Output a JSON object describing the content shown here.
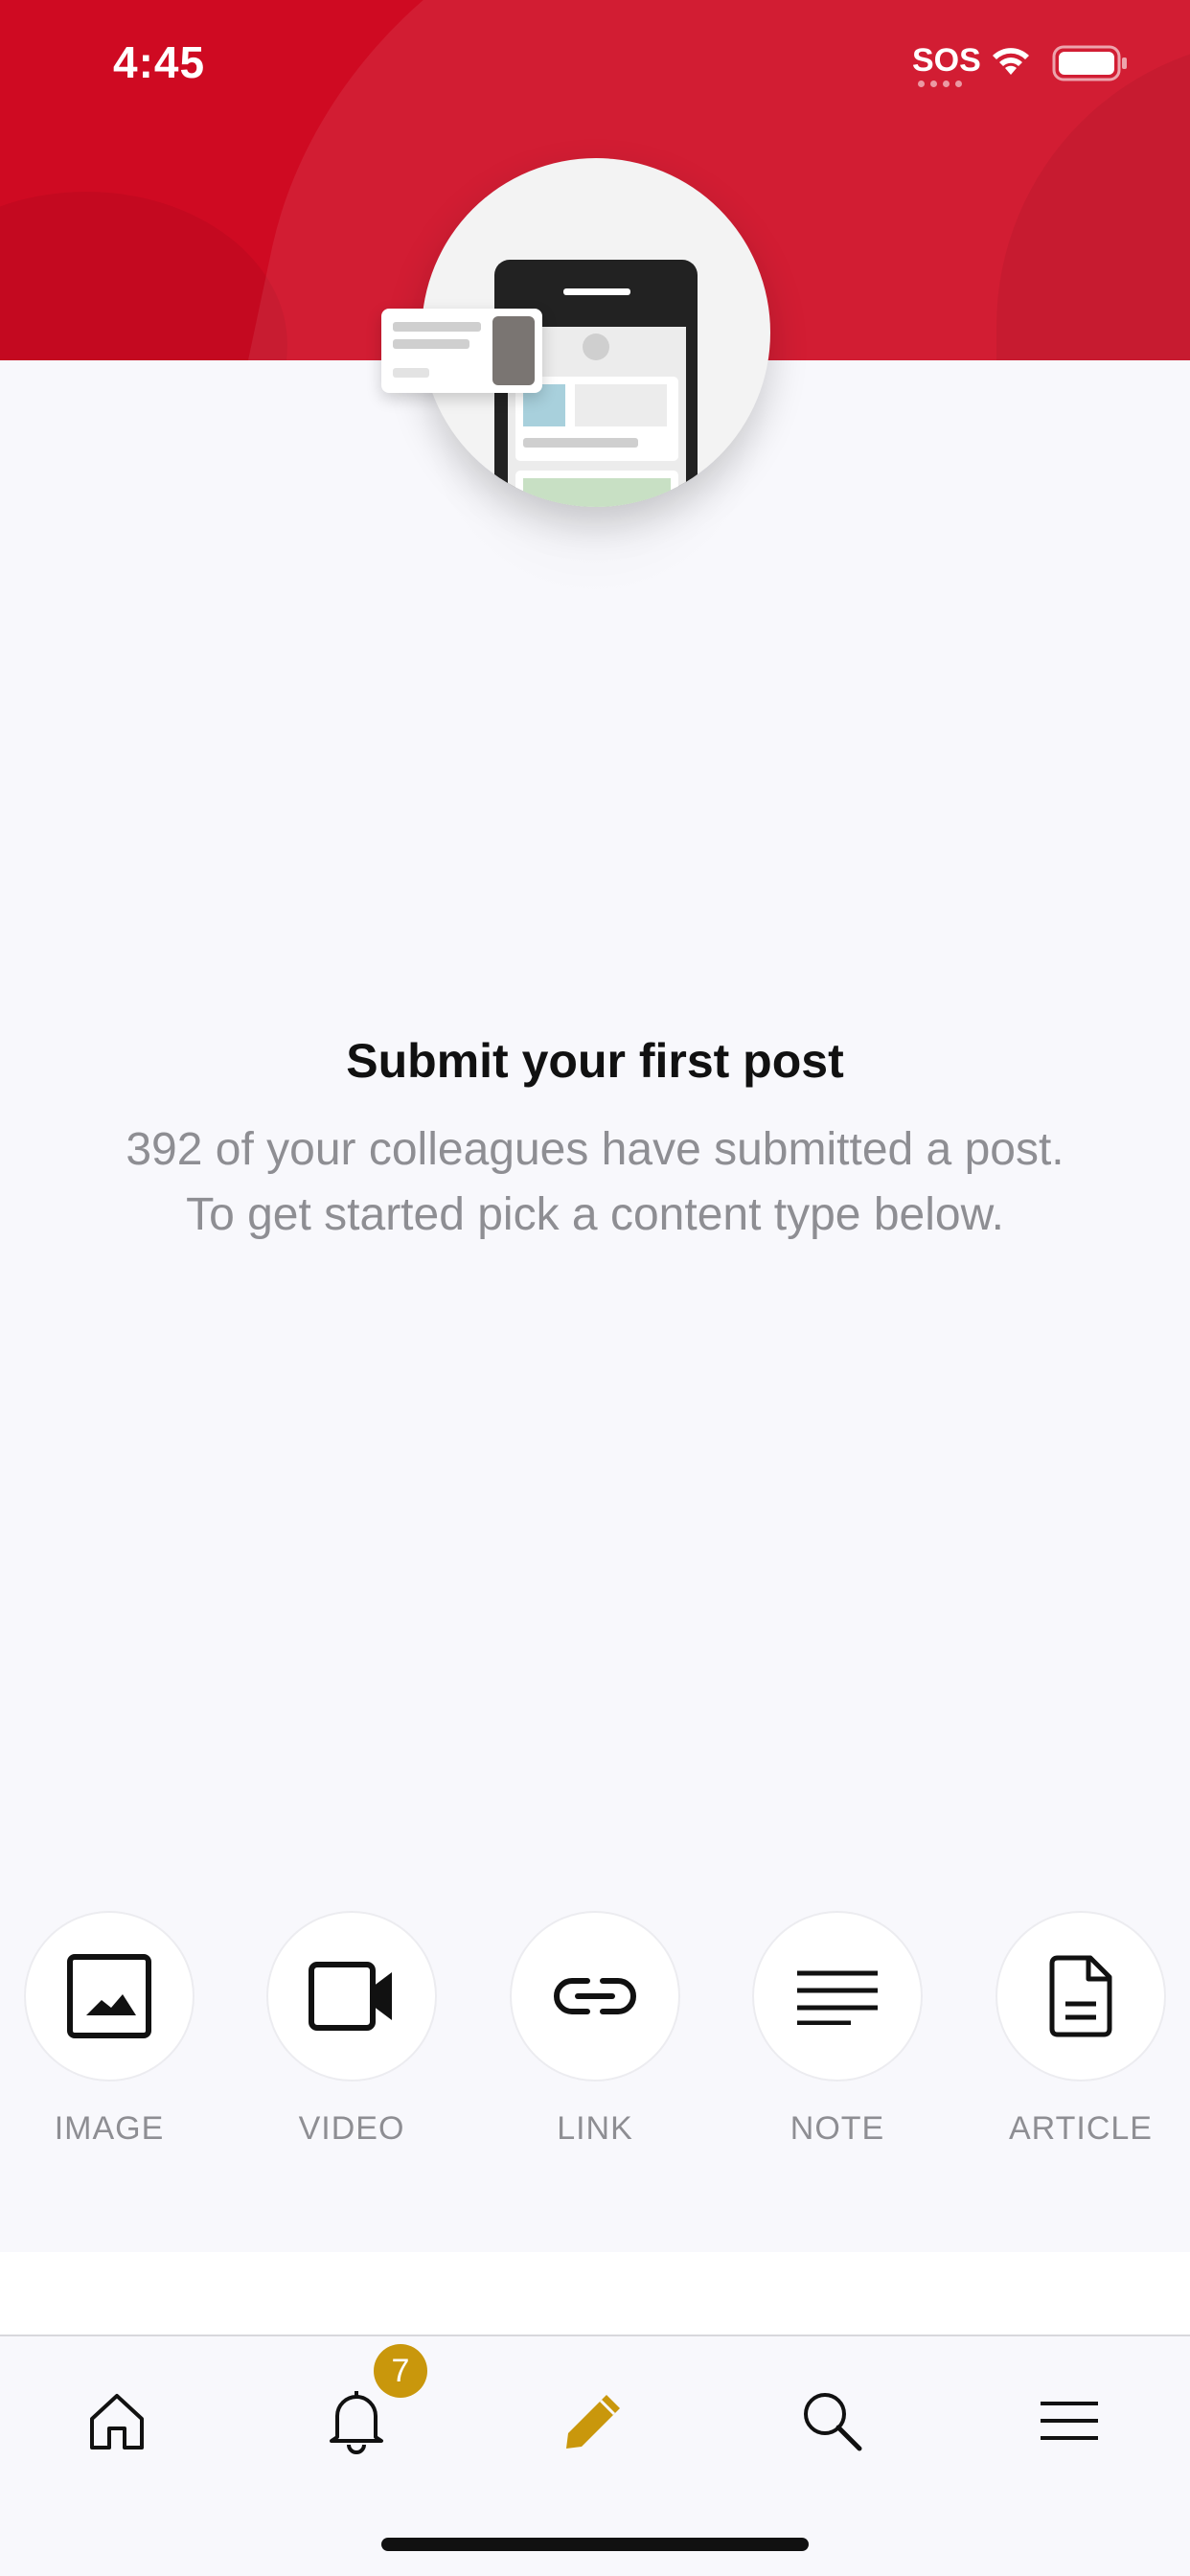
{
  "status_bar": {
    "time": "4:45",
    "sos": "SOS",
    "wifi_icon": "wifi-icon",
    "battery_icon": "battery-icon"
  },
  "colors": {
    "header_red": "#cf0a22",
    "accent_gold": "#c9970c",
    "text_gray": "#8e8e93"
  },
  "empty_state": {
    "title": "Submit your first post",
    "subtitle_line1": "392 of your colleagues have submitted a post.",
    "subtitle_line2": "To get started pick a content type below."
  },
  "content_types": [
    {
      "label": "IMAGE",
      "icon": "image-icon"
    },
    {
      "label": "VIDEO",
      "icon": "video-icon"
    },
    {
      "label": "LINK",
      "icon": "link-icon"
    },
    {
      "label": "NOTE",
      "icon": "note-icon"
    },
    {
      "label": "ARTICLE",
      "icon": "article-icon"
    }
  ],
  "tab_bar": {
    "items": [
      {
        "icon": "home-icon",
        "active": false
      },
      {
        "icon": "bell-icon",
        "active": false,
        "badge": "7"
      },
      {
        "icon": "pencil-icon",
        "active": true
      },
      {
        "icon": "search-icon",
        "active": false
      },
      {
        "icon": "menu-icon",
        "active": false
      }
    ]
  }
}
